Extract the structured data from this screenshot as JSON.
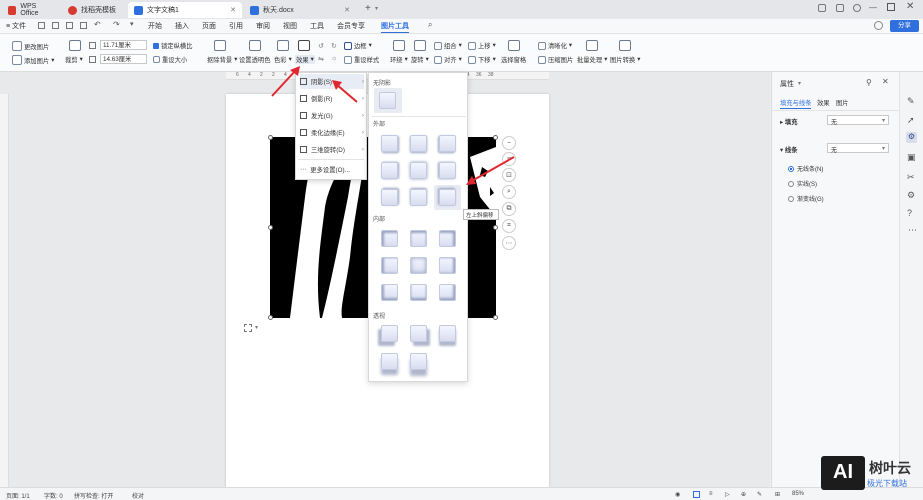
{
  "tabs": [
    {
      "label": "WPS Office",
      "color": "#d73b2f"
    },
    {
      "label": "找稻壳模板",
      "color": "#d73b2f"
    },
    {
      "label": "文字文稿1",
      "color": "#2f6fde"
    },
    {
      "label": "秋天.docx",
      "color": "#2f6fde"
    }
  ],
  "menubar": {
    "file": "≡ 文件",
    "items": [
      "开始",
      "插入",
      "页面",
      "引用",
      "审阅",
      "视图",
      "工具",
      "会员专享",
      "图片工具"
    ],
    "active": "图片工具",
    "share": "分享"
  },
  "ribbon": {
    "change_pic": "更改图片",
    "add_pic": "添加图片",
    "crop": "裁剪",
    "width_value": "11.71厘米",
    "height_value": "14.63厘米",
    "lock_ratio": "锁定纵横比",
    "reset_size": "重设大小",
    "remove_bg": "抠除背景",
    "transparent": "设置透明色",
    "color": "色彩",
    "effects": "效果",
    "border": "边框",
    "reset_style": "重设样式",
    "wrap": "环绕",
    "rotate": "旋转",
    "group": "组合",
    "align": "对齐",
    "up": "上移",
    "down": "下移",
    "select_pane": "选择窗格",
    "sharpen": "清晰化",
    "compress": "压缩图片",
    "batch": "批量处理",
    "convert": "图片转换"
  },
  "effects_menu": {
    "items": [
      "阴影(S)",
      "倒影(R)",
      "发光(G)",
      "柔化边缘(E)",
      "三维旋转(D)"
    ],
    "more": "更多设置(O)..."
  },
  "shadow_panel": {
    "no_shadow": "无阴影",
    "outer": "外部",
    "inner": "内部",
    "perspective": "透视",
    "tooltip": "左上斜偏移"
  },
  "properties": {
    "title": "属性",
    "tabs": [
      "填充与线条",
      "效果",
      "图片"
    ],
    "fill_label": "填充",
    "fill_value": "无",
    "line_label": "线条",
    "line_value": "无",
    "options": [
      "无线条(N)",
      "实线(S)",
      "渐变线(G)"
    ]
  },
  "status": {
    "page": "页面: 1/1",
    "words": "字数: 0",
    "spell": "拼写检查: 打开",
    "proof": "校对",
    "zoom": "85%"
  },
  "ruler_top": [
    "6",
    "4",
    "2",
    "2",
    "4",
    "6",
    "8",
    "10",
    "12",
    "14",
    "16",
    "18",
    "20",
    "22",
    "24",
    "26",
    "28",
    "30",
    "32",
    "34",
    "36",
    "38"
  ],
  "watermark": {
    "line1": "树叶云",
    "line2": "极光下载站"
  }
}
